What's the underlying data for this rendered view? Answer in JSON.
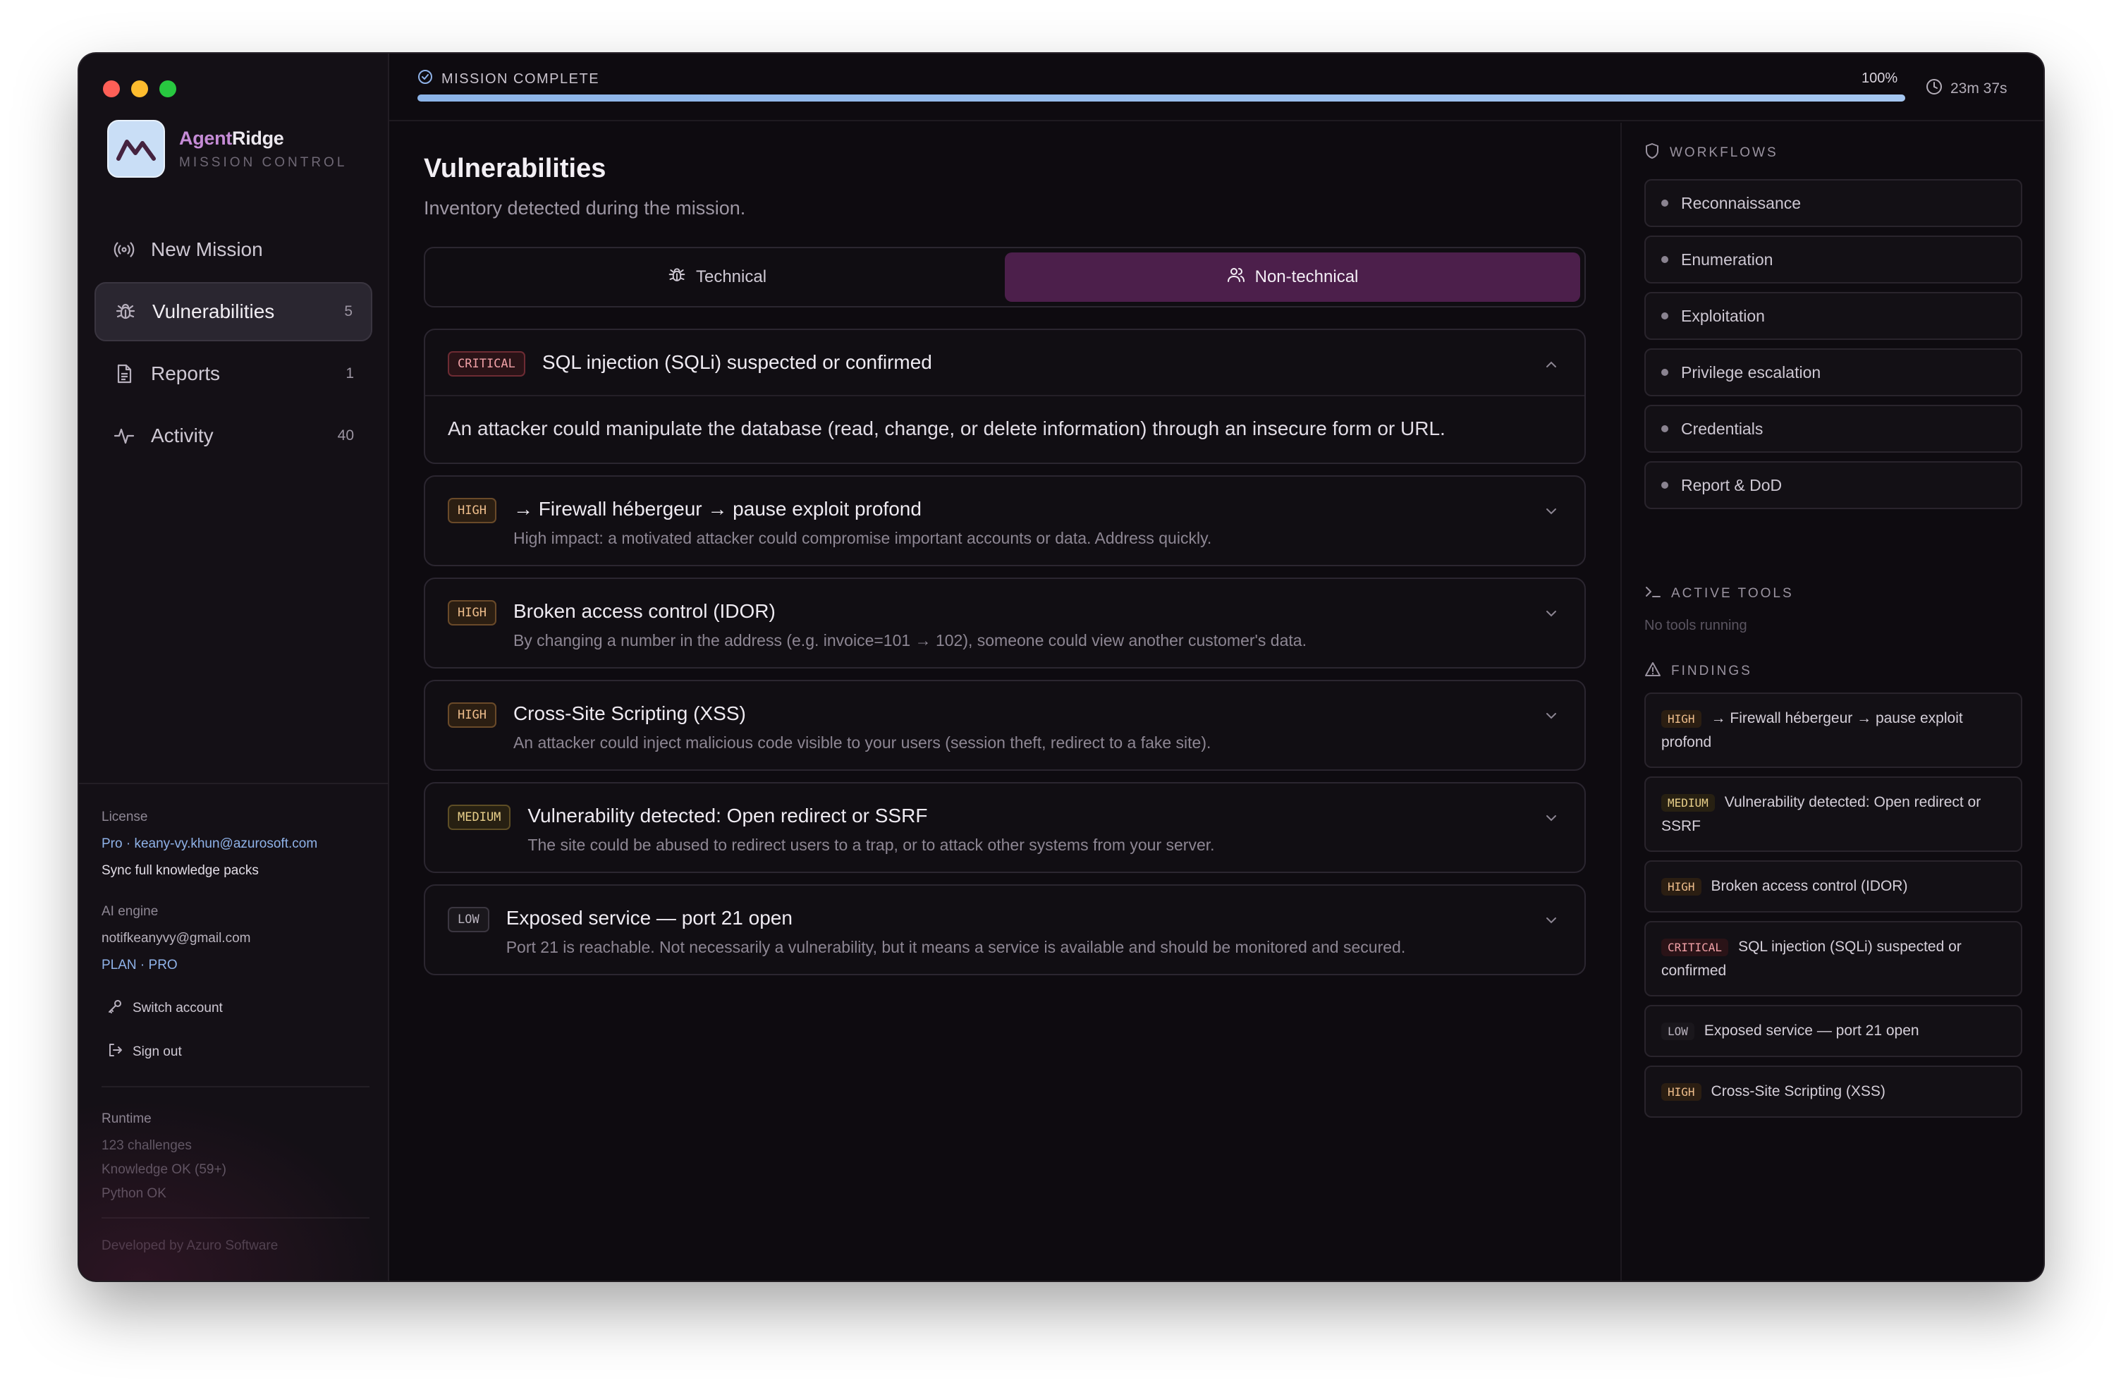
{
  "sidebar": {
    "brand": {
      "name_part1": "Agent",
      "name_part2": "Ridge",
      "subtitle": "MISSION CONTROL"
    },
    "nav": [
      {
        "label": "New Mission",
        "count": "",
        "icon": "radio-broadcast-icon"
      },
      {
        "label": "Vulnerabilities",
        "count": "5",
        "icon": "bug-icon"
      },
      {
        "label": "Reports",
        "count": "1",
        "icon": "document-icon"
      },
      {
        "label": "Activity",
        "count": "40",
        "icon": "activity-pulse-icon"
      }
    ],
    "license": {
      "heading": "License",
      "value": "Pro · keany-vy.khun@azurosoft.com",
      "sync_label": "Sync full knowledge packs"
    },
    "ai_engine": {
      "heading": "AI engine",
      "email": "notifkeanyvy@gmail.com",
      "plan": "PLAN · PRO"
    },
    "actions": {
      "switch_account": "Switch account",
      "sign_out": "Sign out"
    },
    "runtime": {
      "heading": "Runtime",
      "lines": [
        "123 challenges",
        "Knowledge OK (59+)",
        "Python OK"
      ]
    },
    "footer": "Developed by Azuro Software"
  },
  "topbar": {
    "status": "MISSION COMPLETE",
    "progress_percent": 100,
    "progress_label": "100%",
    "timer": "23m 37s"
  },
  "main": {
    "title": "Vulnerabilities",
    "subtitle": "Inventory detected during the mission.",
    "tabs": [
      {
        "label": "Technical",
        "active": false
      },
      {
        "label": "Non-technical",
        "active": true
      }
    ],
    "vulns": [
      {
        "severity": "CRITICAL",
        "level": "critical",
        "title": "SQL injection (SQLi) suspected or confirmed",
        "expanded_text": "An attacker could manipulate the database (read, change, or delete information) through an insecure form or URL."
      },
      {
        "severity": "HIGH",
        "level": "high",
        "title": "→ Firewall hébergeur → pause exploit profond",
        "desc": "High impact: a motivated attacker could compromise important accounts or data. Address quickly."
      },
      {
        "severity": "HIGH",
        "level": "high",
        "title": "Broken access control (IDOR)",
        "desc": "By changing a number in the address (e.g. invoice=101 → 102), someone could view another customer's data."
      },
      {
        "severity": "HIGH",
        "level": "high",
        "title": "Cross-Site Scripting (XSS)",
        "desc": "An attacker could inject malicious code visible to your users (session theft, redirect to a fake site)."
      },
      {
        "severity": "MEDIUM",
        "level": "medium",
        "title": "Vulnerability detected: Open redirect or SSRF",
        "desc": "The site could be abused to redirect users to a trap, or to attack other systems from your server."
      },
      {
        "severity": "LOW",
        "level": "low",
        "title": "Exposed service — port 21 open",
        "desc": "Port 21 is reachable. Not necessarily a vulnerability, but it means a service is available and should be monitored and secured."
      }
    ]
  },
  "rpanel": {
    "workflows_heading": "WORKFLOWS",
    "workflows": [
      "Reconnaissance",
      "Enumeration",
      "Exploitation",
      "Privilege escalation",
      "Credentials",
      "Report & DoD"
    ],
    "tools_heading": "ACTIVE TOOLS",
    "tools_empty": "No tools running",
    "findings_heading": "FINDINGS",
    "findings": [
      {
        "severity": "HIGH",
        "level": "high",
        "title": "→ Firewall hébergeur → pause exploit profond"
      },
      {
        "severity": "MEDIUM",
        "level": "medium",
        "title": "Vulnerability detected: Open redirect or SSRF"
      },
      {
        "severity": "HIGH",
        "level": "high",
        "title": "Broken access control (IDOR)"
      },
      {
        "severity": "CRITICAL",
        "level": "critical",
        "title": "SQL injection (SQLi) suspected or confirmed"
      },
      {
        "severity": "LOW",
        "level": "low",
        "title": "Exposed service — port 21 open"
      },
      {
        "severity": "HIGH",
        "level": "high",
        "title": "Cross-Site Scripting (XSS)"
      }
    ]
  },
  "colors": {
    "accent_tab": "#4c1f4b",
    "progress": "#9bbdea",
    "critical": "#f0a0a6",
    "high": "#efbe8c",
    "medium": "#e8cf8a",
    "low": "#b9b3be"
  }
}
